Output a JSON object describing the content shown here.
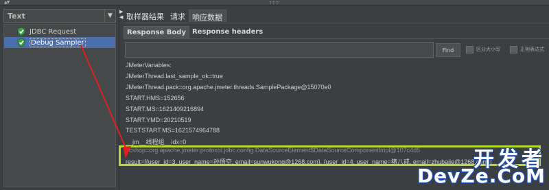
{
  "left": {
    "renderer": "Text",
    "tree": [
      {
        "label": "JDBC Request",
        "icon": "check-shield-icon",
        "selected": false
      },
      {
        "label": "Debug Sampler",
        "icon": "check-shield-icon",
        "selected": true
      }
    ]
  },
  "tabs": [
    "取样器结果",
    "请求",
    "响应数据"
  ],
  "subtabs": [
    "Response Body",
    "Response headers"
  ],
  "search": {
    "value": "",
    "find_label": "Find",
    "case_label": "区分大小写",
    "regex_label": "正则表达式"
  },
  "response_lines": [
    "JMeterVariables:",
    "JMeterThread.last_sample_ok=true",
    "JMeterThread.pack=org.apache.jmeter.threads.SamplePackage@15070e0",
    "START.HMS=152656",
    "START.MS=1621409216894",
    "START.YMD=20210519",
    "TESTSTART.MS=1621574964788",
    "__jm__线程组__idx=0",
    "ecshop=org.apache.jmeter.protocol.jdbc.config.DataSourceElement$DataSourceComponentImpl@107c4d5",
    "result=[{user_id=3, user_name=孙悟空, email=sunwukong@1268.com}, {user_id=4, user_name=猪八戒, email=zhubajie@1268.com}]"
  ],
  "watermark": {
    "cn": "开发者",
    "en": "DevZe.CoM"
  },
  "colors": {
    "highlight": "#b5dc2c",
    "arrow": "#e02020",
    "selection": "#4b6eaf"
  }
}
